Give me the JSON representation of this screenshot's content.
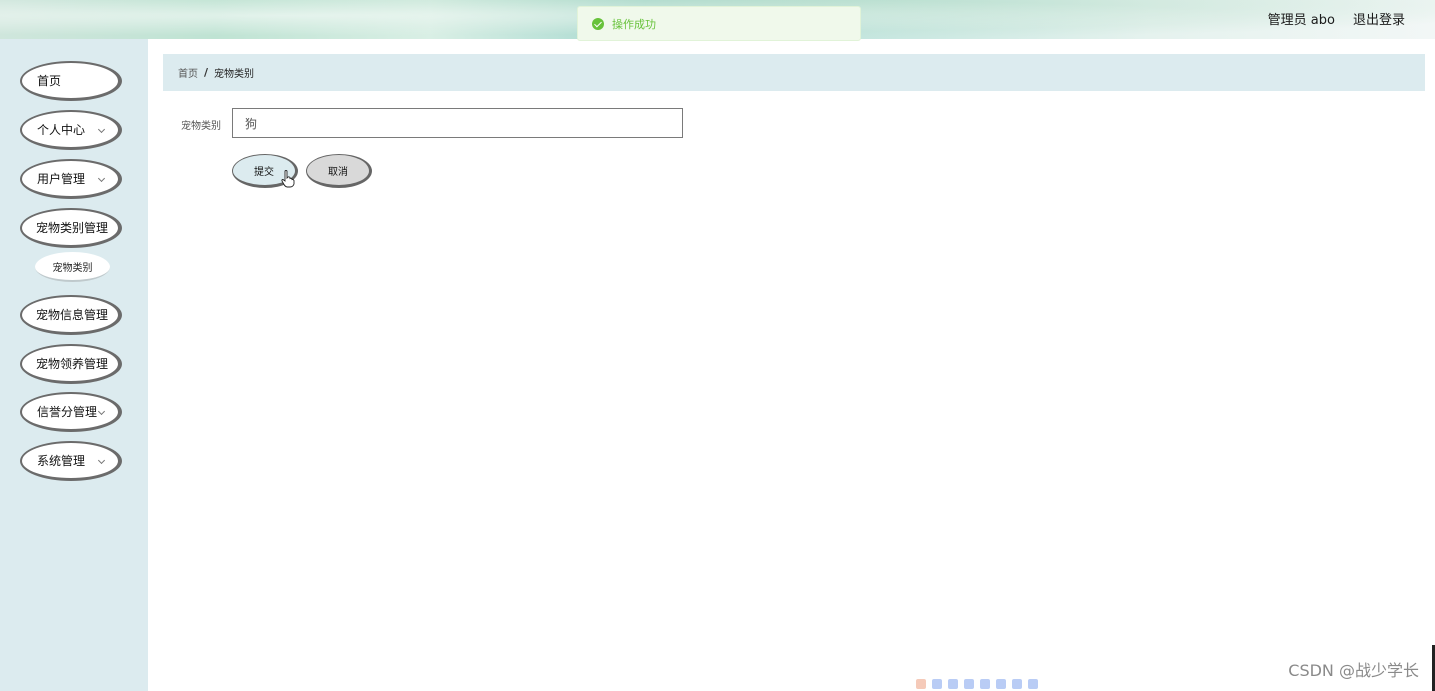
{
  "header": {
    "user_label": "管理员 abo",
    "logout_label": "退出登录"
  },
  "toast": {
    "message": "操作成功",
    "color": "#67c23a"
  },
  "sidebar": {
    "items": [
      {
        "label": "首页",
        "has_chevron": false
      },
      {
        "label": "个人中心",
        "has_chevron": true
      },
      {
        "label": "用户管理",
        "has_chevron": true
      },
      {
        "label": "宠物类别管理",
        "has_chevron": false
      },
      {
        "label": "宠物信息管理",
        "has_chevron": false
      },
      {
        "label": "宠物领养管理",
        "has_chevron": false
      },
      {
        "label": "信誉分管理",
        "has_chevron": true
      },
      {
        "label": "系统管理",
        "has_chevron": true
      }
    ],
    "submenu": [
      {
        "label": "宠物类别"
      }
    ]
  },
  "breadcrumb": {
    "home": "首页",
    "separator": "/",
    "current": "宠物类别"
  },
  "form": {
    "field_label": "宠物类别",
    "field_value": "狗",
    "submit_label": "提交",
    "cancel_label": "取消"
  },
  "watermark": "CSDN @战少学长",
  "colors": {
    "sidebar_bg": "#dcebef",
    "breadcrumb_bg": "#dcebef",
    "toast_bg": "#f0f9eb"
  }
}
